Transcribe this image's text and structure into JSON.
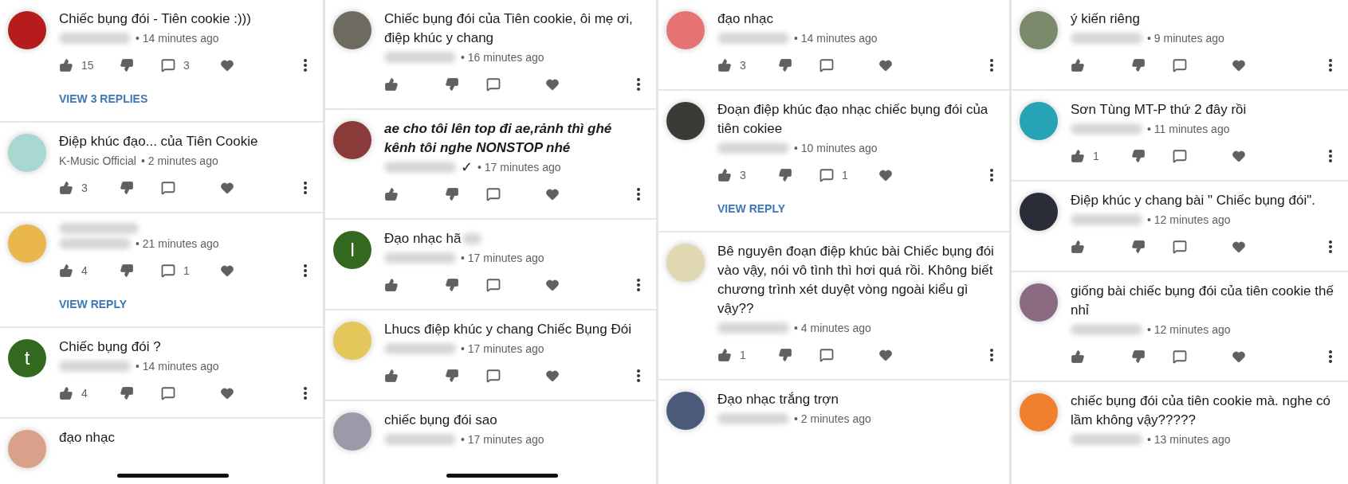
{
  "panels": [
    {
      "home_indicator": true,
      "comments": [
        {
          "avatar": {
            "color": "#b71c1c"
          },
          "text": "Chiếc bụng đói - Tiên cookie :)))",
          "time": "• 14 minutes ago",
          "likes": "15",
          "replies": "3",
          "view_replies": "VIEW 3 REPLIES"
        },
        {
          "avatar": {
            "color": "#a8d8cf"
          },
          "text": "Điệp khúc đạo... của Tiên Cookie",
          "author": "K-Music Official",
          "time": "• 2 minutes ago",
          "likes": "3"
        },
        {
          "avatar": {
            "color": "#e8b64a"
          },
          "time": "• 21 minutes ago",
          "likes": "4",
          "replies": "1",
          "view_replies": "VIEW REPLY"
        },
        {
          "avatar": {
            "color": "#33691e",
            "letter": "t"
          },
          "text": "Chiếc bụng đói ?",
          "time": "• 14 minutes ago",
          "likes": "4"
        },
        {
          "avatar": {
            "color": "#d9a08a"
          },
          "text": "đạo nhạc",
          "cut": true
        }
      ]
    },
    {
      "home_indicator": true,
      "comments": [
        {
          "avatar": {
            "color": "#6d6a5f"
          },
          "text": "Chiếc bụng đói của Tiên cookie, ôi mẹ ơi, điệp khúc y chang",
          "time": "• 16 minutes ago"
        },
        {
          "avatar": {
            "color": "#8b3a3a"
          },
          "text": "ae cho tôi lên top đi ae,rảnh thì ghé kênh tôi nghe NONSTOP nhé",
          "emphasis": true,
          "badge": "✓",
          "time": "• 17 minutes ago"
        },
        {
          "avatar": {
            "color": "#33691e",
            "letter": "I"
          },
          "text": "Đạo nhạc hã",
          "tail_blurred": true,
          "time": "• 17 minutes ago"
        },
        {
          "avatar": {
            "color": "#e3c75a"
          },
          "text": "Lhucs điệp khúc y chang Chiếc Bụng Đói",
          "time": "• 17 minutes ago"
        },
        {
          "avatar": {
            "color": "#9a9aa8"
          },
          "text": "chiếc bụng đói sao",
          "time": "• 17 minutes ago",
          "cut": true
        }
      ]
    },
    {
      "comments": [
        {
          "avatar": {
            "color": "#e57373"
          },
          "text": "đạo nhạc",
          "time": "• 14 minutes ago",
          "likes": "3"
        },
        {
          "avatar": {
            "color": "#3a3a36"
          },
          "text": "Đoạn điệp khúc đạo nhạc chiếc bụng đói của tiên cokiee",
          "time": "• 10 minutes ago",
          "likes": "3",
          "replies": "1",
          "view_replies": "VIEW REPLY"
        },
        {
          "avatar": {
            "color": "#e0d8b0"
          },
          "text": "Bê nguyên đoạn điệp khúc bài Chiếc bụng đói vào vậy, nói vô tình thì hơi quá rồi. Không biết chương trình xét duyệt vòng ngoài kiểu gì vậy??",
          "time": "• 4 minutes ago",
          "likes": "1"
        },
        {
          "avatar": {
            "color": "#4a5a78"
          },
          "text": "Đạo nhạc trắng trợn",
          "time": "• 2 minutes ago",
          "cut": true
        }
      ]
    },
    {
      "comments": [
        {
          "avatar": {
            "color": "#7a8a6a"
          },
          "text": "ý kiến riêng",
          "time": "• 9 minutes ago"
        },
        {
          "avatar": {
            "color": "#26a3b5"
          },
          "text": "Sơn Tùng MT-P thứ 2 đây rồi",
          "time": "• 11 minutes ago",
          "likes": "1"
        },
        {
          "avatar": {
            "color": "#2a2d38"
          },
          "text": "Điệp khúc y chang bài \" Chiếc bụng đói\".",
          "time": "• 12 minutes ago"
        },
        {
          "avatar": {
            "color": "#8a6a80"
          },
          "text": "giống bài chiếc bụng đói của tiên cookie thế nhỉ",
          "time": "• 12 minutes ago"
        },
        {
          "avatar": {
            "color": "#f07f2e"
          },
          "text": "chiếc bụng đói của tiên cookie mà. nghe có lầm không vậy?????",
          "time": "• 13 minutes ago",
          "cut": true
        }
      ]
    }
  ]
}
